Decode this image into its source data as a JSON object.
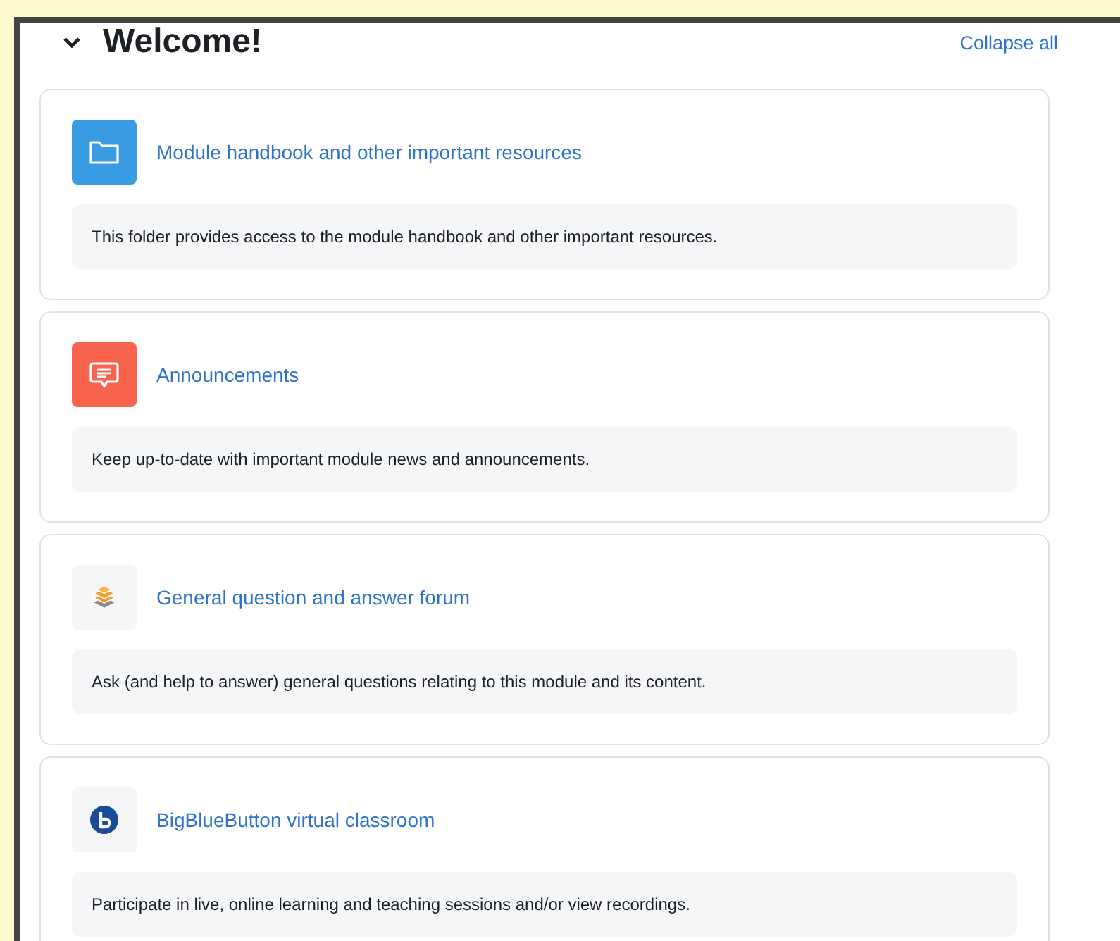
{
  "section": {
    "title": "Welcome!",
    "expanded": true,
    "collapse_link": "Collapse all"
  },
  "activities": [
    {
      "kind": "folder",
      "title": "Module handbook and other important resources",
      "description": "This folder provides access to the module handbook and other important resources."
    },
    {
      "kind": "announcements",
      "title": "Announcements",
      "description": "Keep up-to-date with important module news and announcements."
    },
    {
      "kind": "forum",
      "title": "General question and answer forum",
      "description": "Ask (and help to answer) general questions relating to this module and its content."
    },
    {
      "kind": "bigbluebutton",
      "title": "BigBlueButton virtual classroom",
      "description": "Participate in live, online learning and teaching sessions and/or view recordings."
    }
  ]
}
